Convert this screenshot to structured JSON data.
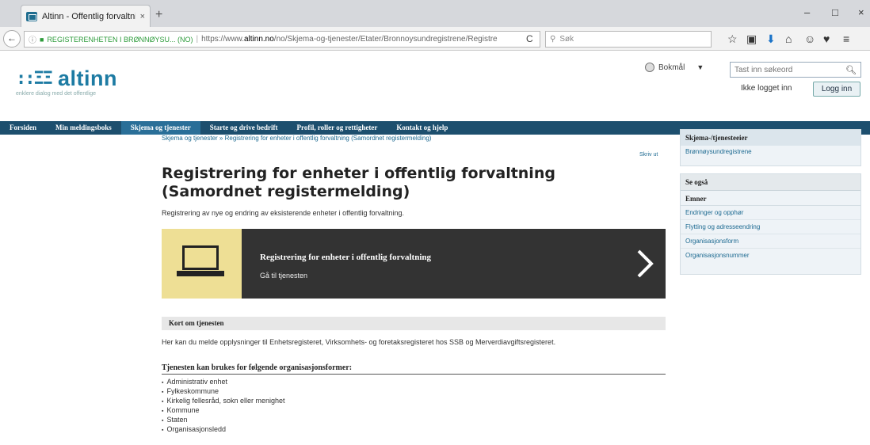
{
  "browser": {
    "tab_title": "Altinn - Offentlig forvaltni...",
    "tab_close": "×",
    "new_tab": "+",
    "win_minimize": "–",
    "win_maximize": "□",
    "win_close": "×",
    "back": "←",
    "identity": "REGISTERENHETEN I BRØNNØYSU... (NO)",
    "url_prefix": "https://www.",
    "url_domain": "altinn.no",
    "url_path": "/no/Skjema-og-tjenester/Etater/Bronnoysundregistrene/Registre",
    "reload": "C",
    "search_placeholder": "Søk"
  },
  "header": {
    "logo_mark": "::ΞΞ",
    "logo_text": "altinn",
    "tagline": "enklere dialog med det offentlige",
    "language": "Bokmål",
    "search_placeholder": "Tast inn søkeord",
    "login_status": "Ikke logget inn",
    "login_button": "Logg inn"
  },
  "nav": {
    "items": [
      "Forsiden",
      "Min meldingsboks",
      "Skjema og tjenester",
      "Starte og drive bedrift",
      "Profil, roller og rettigheter",
      "Kontakt og hjelp"
    ],
    "active_index": 2
  },
  "content": {
    "breadcrumb": "Skjema og tjenester  »  Registrering for enheter i offentlig forvaltning (Samordnet registermelding)",
    "print": "Skriv ut",
    "title": "Registrering for enheter i offentlig forvaltning (Samordnet registermelding)",
    "lead": "Registrering av nye og endring av eksisterende enheter i offentlig forvaltning.",
    "cta_title": "Registrering for enheter i offentlig forvaltning",
    "cta_sub": "Gå til tjenesten",
    "section_head": "Kort om tjenesten",
    "section_text": "Her kan du melde opplysninger til Enhetsregisteret, Virksomhets- og foretaksregisteret hos SSB og Merverdiavgiftsregisteret.",
    "orgs_head": "Tjenesten kan brukes for følgende organisasjonsformer:",
    "orgs": [
      "Administrativ enhet",
      "Fylkeskommune",
      "Kirkelig fellesråd, sokn eller menighet",
      "Kommune",
      "Staten",
      "Organisasjonsledd"
    ]
  },
  "sidebar": {
    "owner_head": "Skjema-/tjenesteeier",
    "owner_link": "Brønnøysundregistrene",
    "see_also": "Se også",
    "topics": "Emner",
    "links": [
      "Endringer og opphør",
      "Flytting og adresseendring",
      "Organisasjonsform",
      "Organisasjonsnummer"
    ]
  },
  "colors": {
    "brand": "#1d7ba3",
    "nav_bg": "#1d4f6e",
    "nav_active": "#2a6f98",
    "cta_icon_bg": "#eedf95",
    "cta_bg": "#333333"
  }
}
